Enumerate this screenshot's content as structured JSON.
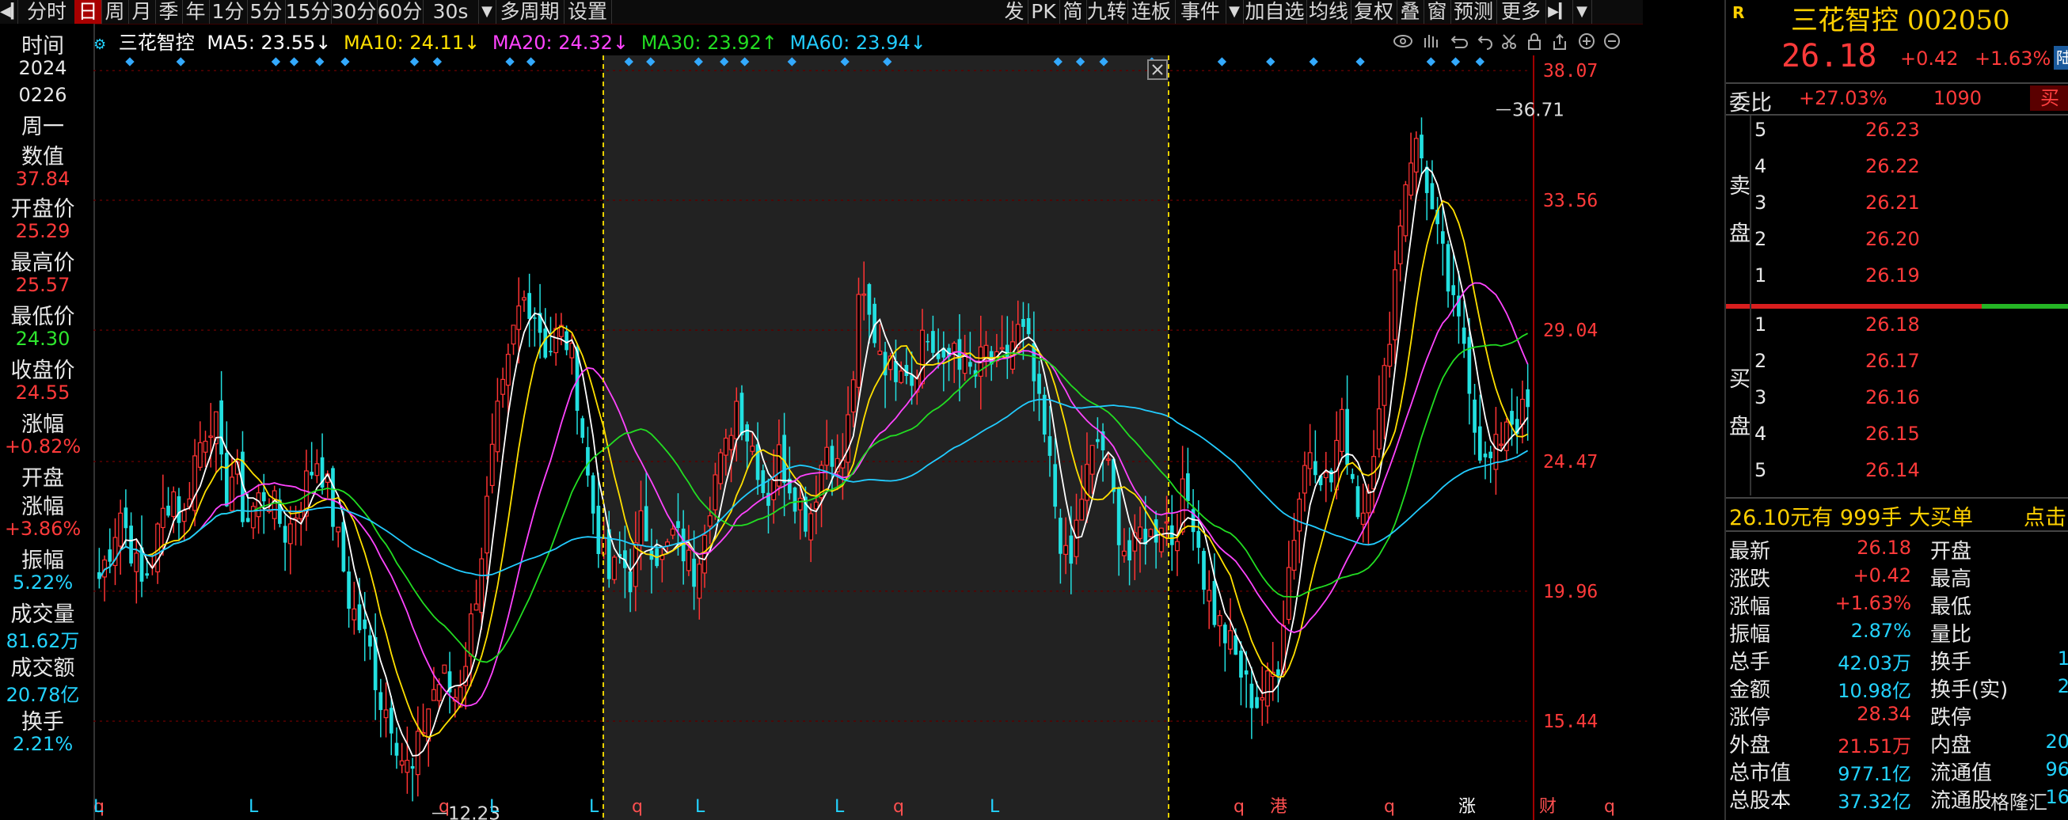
{
  "toolbar": {
    "items": [
      "分时",
      "日",
      "周",
      "月",
      "季",
      "年",
      "1分",
      "5分",
      "15分",
      "30分",
      "60分",
      "30s",
      "多周期",
      "设置"
    ],
    "active_index": 1,
    "right_items": [
      "发",
      "PK",
      "简",
      "九转",
      "连板",
      "事件",
      "加自选",
      "均线",
      "复权",
      "叠",
      "窗",
      "预测",
      "更多"
    ]
  },
  "left_panel": {
    "time_label": "时间",
    "year": "2024",
    "date": "0226",
    "weekday": "周一",
    "value_label": "数值",
    "value": "37.84",
    "open_label": "开盘价",
    "open": "25.29",
    "high_label": "最高价",
    "high": "25.57",
    "low_label": "最低价",
    "low": "24.30",
    "close_label": "收盘价",
    "close": "24.55",
    "change_label": "涨幅",
    "change": "+0.82%",
    "open_change_label1": "开盘",
    "open_change_label2": "涨幅",
    "open_change": "+3.86%",
    "amplitude_label": "振幅",
    "amplitude": "5.22%",
    "volume_label": "成交量",
    "volume": "81.62万",
    "amount_label": "成交额",
    "amount": "20.78亿",
    "turnover_label": "换手",
    "turnover": "2.21%"
  },
  "ma_legend": {
    "name": "三花智控",
    "ma5": "MA5: 23.55↓",
    "ma10": "MA10: 24.11↓",
    "ma20": "MA20: 24.32↓",
    "ma30": "MA30: 23.92↑",
    "ma60": "MA60: 23.94↓",
    "colors": {
      "ma5": "#ffffff",
      "ma10": "#ffe000",
      "ma20": "#ff44ff",
      "ma30": "#22dd22",
      "ma60": "#22ccff"
    }
  },
  "chart_data": {
    "type": "candlestick",
    "y_ticks": [
      38.07,
      33.56,
      29.04,
      24.47,
      19.96,
      15.44
    ],
    "ylim": [
      12.0,
      38.6
    ],
    "max_label": "36.71",
    "min_label": "12.23",
    "close_path": [
      20.4,
      21.5,
      22.8,
      21.6,
      20.1,
      21.0,
      22.5,
      23.6,
      22.2,
      24.4,
      25.5,
      26.2,
      23.2,
      24.3,
      22.3,
      23.0,
      23.5,
      22.6,
      21.9,
      22.9,
      23.9,
      24.7,
      23.3,
      21.5,
      19.6,
      18.7,
      17.8,
      16.2,
      15.6,
      14.2,
      13.5,
      15.2,
      16.5,
      17.0,
      16.2,
      17.4,
      19.6,
      22.3,
      25.6,
      27.2,
      29.5,
      30.3,
      29.5,
      28.2,
      29.0,
      28.6,
      26.6,
      23.4,
      21.6,
      20.3,
      21.1,
      20.4,
      22.3,
      21.7,
      20.9,
      21.9,
      21.4,
      20.5,
      22.4,
      23.9,
      24.6,
      26.7,
      25.6,
      24.7,
      23.0,
      24.8,
      24.0,
      23.2,
      22.4,
      24.0,
      25.4,
      23.9,
      26.2,
      30.4,
      29.2,
      28.4,
      27.5,
      28.3,
      27.3,
      29.0,
      28.4,
      27.5,
      28.7,
      27.7,
      27.4,
      28.3,
      27.6,
      28.1,
      29.0,
      28.6,
      26.4,
      24.6,
      22.2,
      20.3,
      23.0,
      24.4,
      25.4,
      23.6,
      21.8,
      20.9,
      22.2,
      21.8,
      22.7,
      21.7,
      23.4,
      22.6,
      20.3,
      19.1,
      18.4,
      17.6,
      16.6,
      16.1,
      16.6,
      17.4,
      20.6,
      23.1,
      25.1,
      24.4,
      23.4,
      26.0,
      24.4,
      22.3,
      24.8,
      26.4,
      30.1,
      33.8,
      35.6,
      34.9,
      32.7,
      31.2,
      29.4,
      28.6,
      25.6,
      24.2,
      24.8,
      26.1,
      25.9,
      26.2
    ]
  },
  "chart_labels": {
    "bottom_markers": [
      "q",
      "L",
      "L",
      "q",
      "L",
      "L",
      "q",
      "L",
      "L",
      "q",
      "L",
      "q",
      "港",
      "q",
      "涨",
      "财",
      "q"
    ]
  },
  "right_panel": {
    "r_badge": "R",
    "name": "三花智控",
    "code": "002050",
    "last_price": "26.18",
    "change": "+0.42",
    "change_pct": "+1.63%",
    "flag": "陆",
    "weibi_label": "委比",
    "weibi_value": "+27.03%",
    "weibi_diff": "1090",
    "buy_tag": "买",
    "sell_label": "卖盘",
    "buy_label": "买盘",
    "asks": [
      {
        "level": "5",
        "price": "26.23"
      },
      {
        "level": "4",
        "price": "26.22"
      },
      {
        "level": "3",
        "price": "26.21"
      },
      {
        "level": "2",
        "price": "26.20"
      },
      {
        "level": "1",
        "price": "26.19"
      }
    ],
    "bids": [
      {
        "level": "1",
        "price": "26.18"
      },
      {
        "level": "2",
        "price": "26.17"
      },
      {
        "level": "3",
        "price": "26.16"
      },
      {
        "level": "4",
        "price": "26.15"
      },
      {
        "level": "5",
        "price": "26.14"
      }
    ],
    "big_order_price": "26.10元有",
    "big_order_vol": "999手",
    "big_order_tag": "大买单",
    "big_order_click": "点击",
    "stats": [
      {
        "l1": "最新",
        "v1": "26.18",
        "c1": "#ff3a3a",
        "l2": "开盘",
        "v2": ""
      },
      {
        "l1": "涨跌",
        "v1": "+0.42",
        "c1": "#ff3a3a",
        "l2": "最高",
        "v2": ""
      },
      {
        "l1": "涨幅",
        "v1": "+1.63%",
        "c1": "#ff3a3a",
        "l2": "最低",
        "v2": ""
      },
      {
        "l1": "振幅",
        "v1": "2.87%",
        "c1": "#23d3ff",
        "l2": "量比",
        "v2": ""
      },
      {
        "l1": "总手",
        "v1": "42.03万",
        "c1": "#23d3ff",
        "l2": "换手",
        "v2": "1"
      },
      {
        "l1": "金额",
        "v1": "10.98亿",
        "c1": "#23d3ff",
        "l2": "换手(实)",
        "v2": "2"
      },
      {
        "l1": "涨停",
        "v1": "28.34",
        "c1": "#ff3a3a",
        "l2": "跌停",
        "v2": ""
      },
      {
        "l1": "外盘",
        "v1": "21.51万",
        "c1": "#ff3a3a",
        "l2": "内盘",
        "v2": "20"
      },
      {
        "l1": "总市值",
        "v1": "977.1亿",
        "c1": "#23d3ff",
        "l2": "流通值",
        "v2": "96"
      },
      {
        "l1": "总股本",
        "v1": "37.32亿",
        "c1": "#23d3ff",
        "l2": "流通股",
        "v2": "16"
      }
    ],
    "watermark": "格隆汇"
  }
}
